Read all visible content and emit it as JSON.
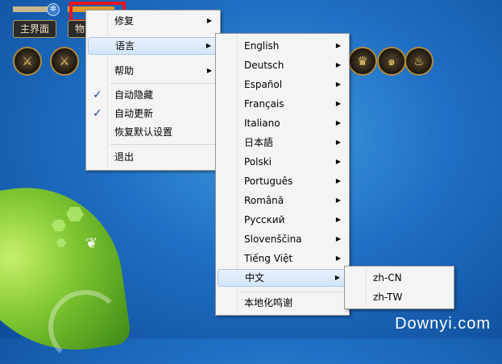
{
  "widget": {
    "tabs": [
      "主界面",
      "物"
    ]
  },
  "main_menu": {
    "items": [
      {
        "label": "修复",
        "has_submenu": true,
        "checked": false
      },
      {
        "label": "语言",
        "has_submenu": true,
        "checked": false,
        "highlighted": true
      },
      {
        "label": "帮助",
        "has_submenu": true,
        "checked": false
      },
      {
        "label": "自动隐藏",
        "has_submenu": false,
        "checked": true
      },
      {
        "label": "自动更新",
        "has_submenu": false,
        "checked": true
      },
      {
        "label": "恢复默认设置",
        "has_submenu": false,
        "checked": false
      },
      {
        "label": "退出",
        "has_submenu": false,
        "checked": false
      }
    ]
  },
  "language_menu": {
    "items": [
      {
        "label": "English",
        "has_submenu": true
      },
      {
        "label": "Deutsch",
        "has_submenu": true
      },
      {
        "label": "Español",
        "has_submenu": true
      },
      {
        "label": "Français",
        "has_submenu": true
      },
      {
        "label": "Italiano",
        "has_submenu": true
      },
      {
        "label": "日本語",
        "has_submenu": true
      },
      {
        "label": "Polski",
        "has_submenu": true
      },
      {
        "label": "Português",
        "has_submenu": true
      },
      {
        "label": "Română",
        "has_submenu": true
      },
      {
        "label": "Русский",
        "has_submenu": true
      },
      {
        "label": "Slovenščina",
        "has_submenu": true
      },
      {
        "label": "Tiếng Việt",
        "has_submenu": true
      },
      {
        "label": "中文",
        "has_submenu": true,
        "highlighted": true
      },
      {
        "label": "本地化鸣谢",
        "has_submenu": false
      }
    ]
  },
  "chinese_menu": {
    "items": [
      "zh-CN",
      "zh-TW"
    ]
  },
  "watermark": "Downyi.com",
  "colors": {
    "highlight": "#d3e5f8",
    "highlight_border": "#a8c8ec",
    "annotation_red": "#e8141c"
  }
}
